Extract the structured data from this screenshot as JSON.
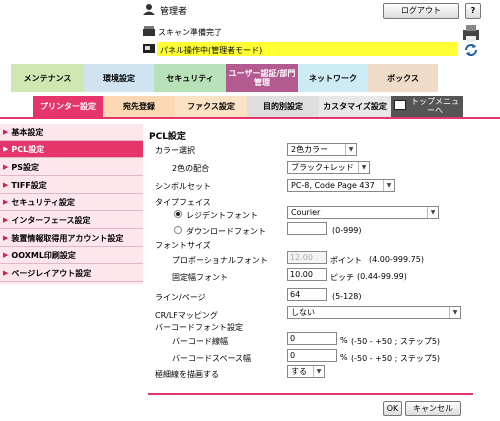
{
  "header": {
    "user_label": "管理者",
    "logout_label": "ログアウト",
    "help_label": "?",
    "status_scan": "スキャン準備完了",
    "status_panel": "パネル操作中(管理者モード)"
  },
  "main_tabs": [
    {
      "label": "メンテナンス"
    },
    {
      "label": "環境設定"
    },
    {
      "label": "セキュリティ"
    },
    {
      "label": "ユーザー認証/部門管理"
    },
    {
      "label": "ネットワーク"
    },
    {
      "label": "ボックス"
    }
  ],
  "sub_tabs": [
    {
      "label": "プリンター設定"
    },
    {
      "label": "宛先登録"
    },
    {
      "label": "ファクス設定"
    },
    {
      "label": "目的別設定"
    },
    {
      "label": "カスタマイズ設定"
    },
    {
      "label": "トップメニューへ"
    }
  ],
  "sidebar": {
    "items": [
      {
        "label": "基本設定"
      },
      {
        "label": "PCL設定"
      },
      {
        "label": "PS設定"
      },
      {
        "label": "TIFF設定"
      },
      {
        "label": "セキュリティ設定"
      },
      {
        "label": "インターフェース設定"
      },
      {
        "label": "装置情報取得用アカウント設定"
      },
      {
        "label": "OOXML印刷設定"
      },
      {
        "label": "ページレイアウト設定"
      }
    ]
  },
  "form": {
    "title": "PCL設定",
    "color_select_label": "カラー選択",
    "color_select_value": "2色カラー",
    "two_color_label": "2色の配合",
    "two_color_value": "ブラック+レッド",
    "symbol_set_label": "シンボルセット",
    "symbol_set_value": "PC-8, Code Page 437",
    "typeface_label": "タイプフェイス",
    "resident_font_label": "レジデントフォント",
    "resident_font_value": "Courier",
    "download_font_label": "ダウンロードフォント",
    "download_font_value": "",
    "download_font_range": "(0-999)",
    "font_size_label": "フォントサイズ",
    "proportional_label": "プロポーショナルフォント",
    "proportional_value": "12.00",
    "proportional_unit": "ポイント",
    "proportional_range": "(4.00-999.75)",
    "fixed_pitch_label": "固定幅フォント",
    "fixed_pitch_value": "10.00",
    "fixed_pitch_unit": "ピッチ",
    "fixed_pitch_range": "(0.44-99.99)",
    "lines_label": "ライン/ページ",
    "lines_value": "64",
    "lines_range": "(5-128)",
    "crlf_label": "CR/LFマッピング",
    "crlf_value": "しない",
    "barcode_label": "バーコードフォント設定",
    "bar_width_label": "バーコード線幅",
    "bar_width_value": "0",
    "bar_width_unit": "%",
    "bar_width_range": "(-50 - +50 ; ステップ5)",
    "bar_space_label": "バーコードスペース幅",
    "bar_space_value": "0",
    "bar_space_unit": "%",
    "bar_space_range": "(-50 - +50 ; ステップ5)",
    "thin_line_label": "極細線を描画する",
    "thin_line_value": "する"
  },
  "footer": {
    "ok_label": "OK",
    "cancel_label": "キャンセル"
  },
  "colors": {
    "accent": "#e6356b",
    "tab_active": "#b43d7a",
    "panel_status": "#ffff33"
  }
}
